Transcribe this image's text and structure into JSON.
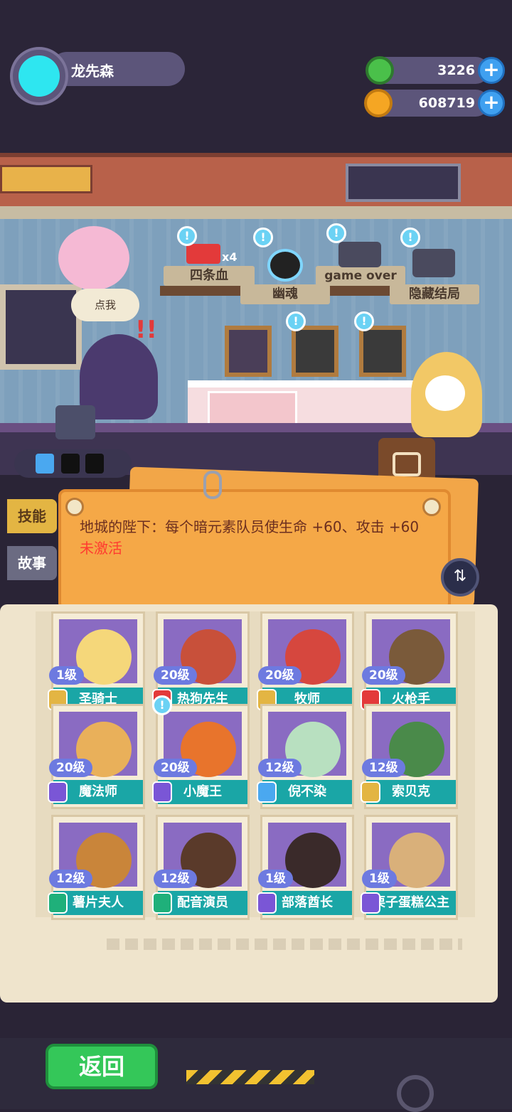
{
  "player": {
    "name": "龙先森"
  },
  "resources": [
    {
      "name": "gems",
      "value": "3226",
      "icon": "donut-gem-icon",
      "color": "#4ac04a"
    },
    {
      "name": "coins",
      "value": "608719",
      "icon": "planet-coin-icon",
      "color": "#f5a623"
    }
  ],
  "achievements": [
    {
      "label": "四条血",
      "badge": "x4"
    },
    {
      "label": "幽魂"
    },
    {
      "label": "game over"
    },
    {
      "label": "隐藏结局"
    }
  ],
  "speech": "点我",
  "tabs": {
    "skill": "技能",
    "story": "故事"
  },
  "skill_note": {
    "text": "地城的陛下：每个暗元素队员使生命 +60、攻击 +60",
    "status": "未激活"
  },
  "heroes": [
    {
      "name": "圣骑士",
      "level": "1级",
      "color": "#f5d77a"
    },
    {
      "name": "热狗先生",
      "level": "20级",
      "color": "#c8503a"
    },
    {
      "name": "牧师",
      "level": "20级",
      "color": "#d6473e"
    },
    {
      "name": "火枪手",
      "level": "20级",
      "color": "#7a5a3a"
    },
    {
      "name": "魔法师",
      "level": "20级",
      "color": "#e9b05a"
    },
    {
      "name": "小魔王",
      "level": "20级",
      "color": "#e8742c"
    },
    {
      "name": "倪不染",
      "level": "12级",
      "color": "#b8e0c0"
    },
    {
      "name": "索贝克",
      "level": "12级",
      "color": "#4a8a4a"
    },
    {
      "name": "薯片夫人",
      "level": "12级",
      "color": "#c9853a"
    },
    {
      "name": "配音演员",
      "level": "12级",
      "color": "#5a3a2a"
    },
    {
      "name": "部落酋长",
      "level": "1级",
      "color": "#3a2a2a"
    },
    {
      "name": "栗子蛋糕公主",
      "level": "1级",
      "color": "#d9b07a"
    }
  ],
  "back_label": "返回"
}
